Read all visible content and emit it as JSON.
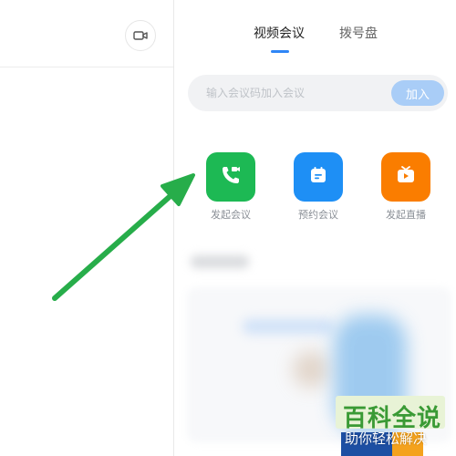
{
  "tabs": {
    "video_meeting": "视频会议",
    "dial_pad": "拨号盘",
    "active_color": "#2f86f6"
  },
  "join": {
    "placeholder": "输入会议码加入会议",
    "button_label": "加入"
  },
  "actions": [
    {
      "label": "发起会议",
      "icon": "phone-video-icon",
      "color": "#1db954"
    },
    {
      "label": "预约会议",
      "icon": "calendar-icon",
      "color": "#1e8ff5"
    },
    {
      "label": "发起直播",
      "icon": "tv-play-icon",
      "color": "#fa7d00"
    }
  ],
  "annotation": {
    "arrow_color": "#27ad4a"
  },
  "watermark": {
    "title": "百科全说",
    "subtitle": "助你轻松解决"
  }
}
